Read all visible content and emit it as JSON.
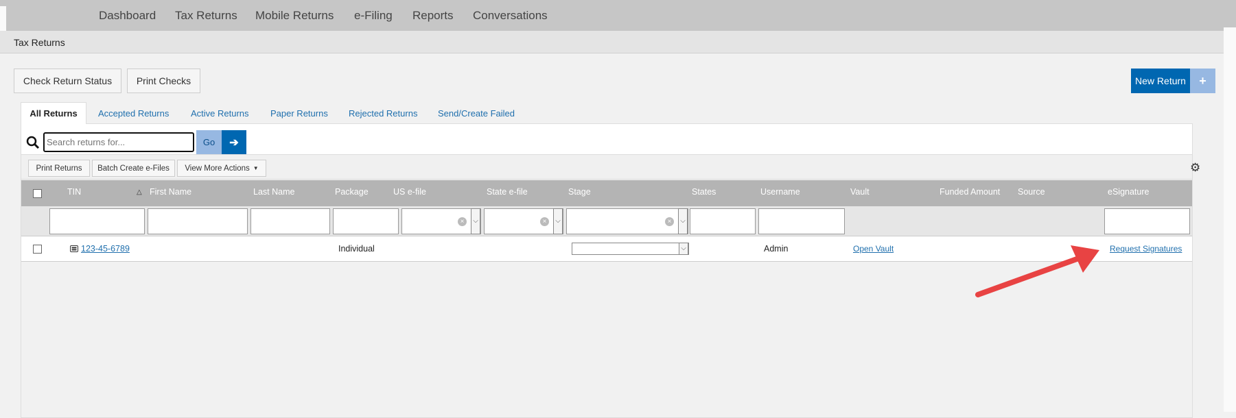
{
  "nav": {
    "items": [
      "Dashboard",
      "Tax Returns",
      "Mobile Returns",
      "e-Filing",
      "Reports",
      "Conversations"
    ]
  },
  "breadcrumb": "Tax Returns",
  "actions": {
    "check_status": "Check Return Status",
    "print_checks": "Print Checks",
    "new_return": "New Return"
  },
  "tabs": [
    "All Returns",
    "Accepted Returns",
    "Active Returns",
    "Paper Returns",
    "Rejected Returns",
    "Send/Create Failed"
  ],
  "search": {
    "placeholder": "Search returns for...",
    "go": "Go"
  },
  "toolbar": {
    "print_returns": "Print Returns",
    "batch": "Batch Create e-Files",
    "more": "View More Actions"
  },
  "columns": [
    "TIN",
    "First Name",
    "Last Name",
    "Package",
    "US e-file",
    "State e-file",
    "Stage",
    "States",
    "Username",
    "Vault",
    "Funded Amount",
    "Source",
    "eSignature"
  ],
  "rows": [
    {
      "tin": "123-45-6789",
      "package": "Individual",
      "username": "Admin",
      "vault": "Open Vault",
      "esignature": "Request Signatures"
    }
  ],
  "colors": {
    "primary": "#0067b1",
    "secondary": "#97b8e2",
    "annotation_arrow": "#e84343"
  }
}
